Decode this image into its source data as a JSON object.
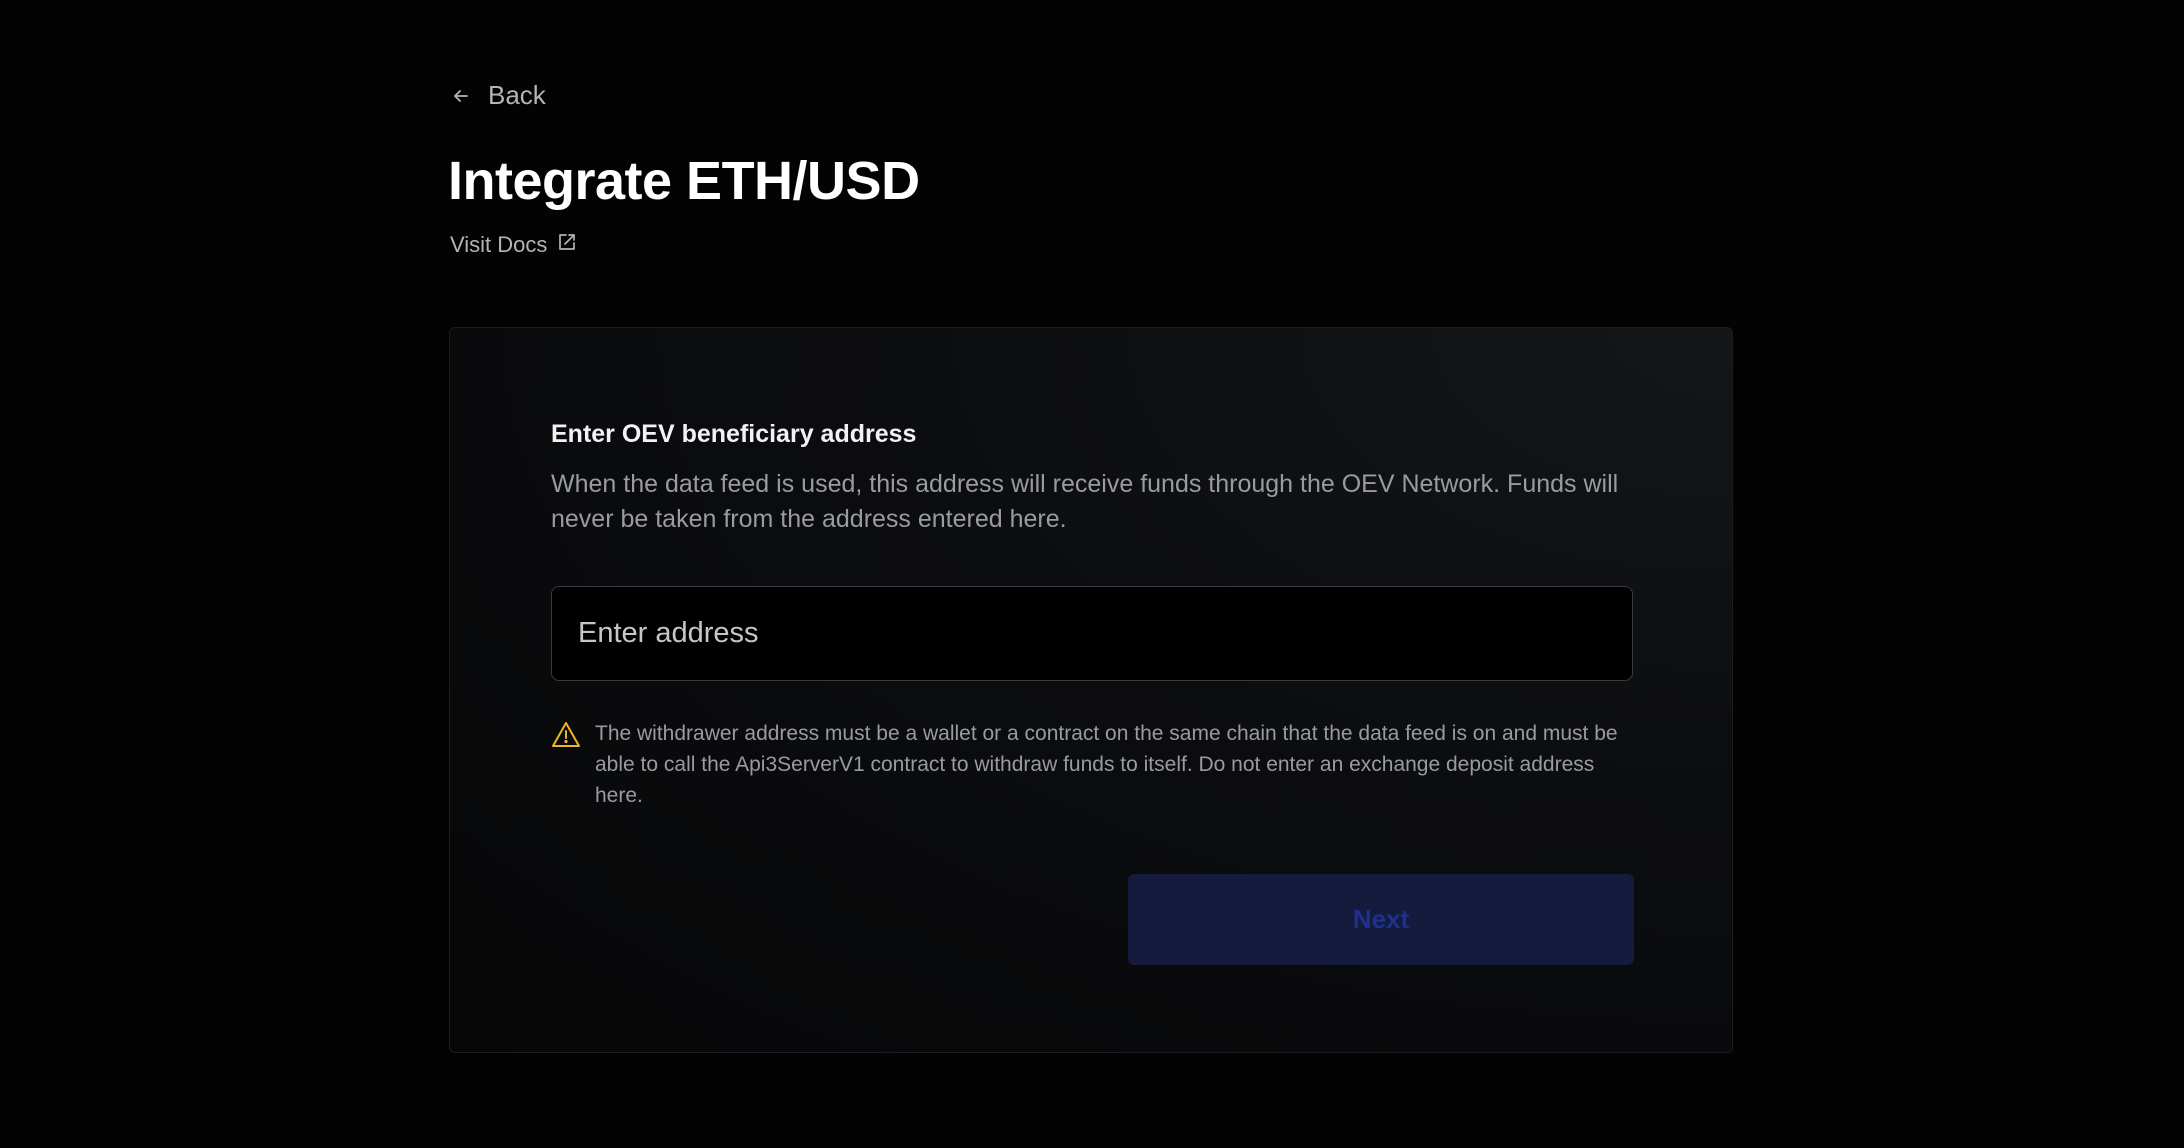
{
  "nav": {
    "back_label": "Back"
  },
  "header": {
    "title": "Integrate ETH/USD",
    "docs_link_label": "Visit Docs"
  },
  "form": {
    "section_title": "Enter OEV beneficiary address",
    "description": "When the data feed is used, this address will receive funds through the OEV Network. Funds will never be taken from the address entered here.",
    "address_input": {
      "value": "",
      "placeholder": "Enter address"
    },
    "warning_text": "The withdrawer address must be a wallet or a contract on the same chain that the data feed is on and must be able to call the Api3ServerV1 contract to withdraw funds to itself. Do not enter an exchange deposit address here.",
    "next_label": "Next"
  },
  "icons": {
    "back": "arrow-left-icon",
    "docs": "external-link-icon",
    "warning": "warning-triangle-icon"
  },
  "colors": {
    "background": "#030303",
    "warning_accent": "#f0b429",
    "button_bg": "#141b3d",
    "button_text": "#1f3190"
  }
}
